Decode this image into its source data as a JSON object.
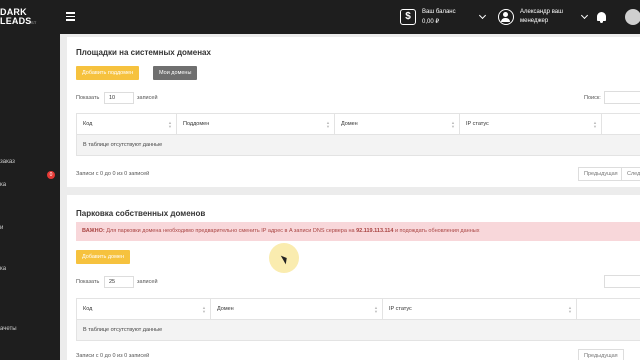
{
  "header": {
    "logo_line1": "DARK",
    "logo_line2": "LEADS",
    "logo_sub": "ST",
    "balance_icon": "$",
    "balance_label": "Ваш баланс",
    "balance_value": "0,00 ₽",
    "user_name": "Александр ваш",
    "user_role": "менеджер"
  },
  "sidebar": {
    "badge": "0",
    "items": [
      "заказ",
      "ка",
      "и",
      "ка",
      "ачеты"
    ]
  },
  "section1": {
    "title": "Площадки на системных доменах",
    "add_subdomain_button": "Добавить поддомен",
    "my_domains_button": "Мои домены",
    "show_label": "Показать",
    "page_size": "10",
    "records_label": "записей",
    "search_label": "Поиск:",
    "columns": [
      "Код",
      "Поддомен",
      "Домен",
      "IP статус"
    ],
    "empty_text": "В таблице отсутствуют данные",
    "info_text": "Записи с 0 до 0 из 0 записей",
    "prev_button": "Предыдущая",
    "next_button": "След"
  },
  "section2": {
    "title": "Парковка собственных доменов",
    "alert_prefix": "ВАЖНО:",
    "alert_text": "Для парковки домена необходимо предварительно сменить IP адрес в A записи DNS сервера на",
    "alert_ip": "92.119.113.114",
    "alert_suffix": "и подождать обновления данных",
    "add_domain_button": "Добавить домен",
    "show_label": "Показать",
    "page_size": "25",
    "records_label": "записей",
    "columns": [
      "Код",
      "Домен",
      "IP статус"
    ],
    "empty_text": "В таблице отсутствуют данные",
    "info_text": "Записи с 0 до 0 из 0 записей",
    "prev_button": "Предыдущая"
  },
  "colors": {
    "topbar": "#1e1e1e",
    "accent_yellow": "#f6c23e",
    "alert_bg": "#f8d7da",
    "badge_red": "#e53935"
  }
}
